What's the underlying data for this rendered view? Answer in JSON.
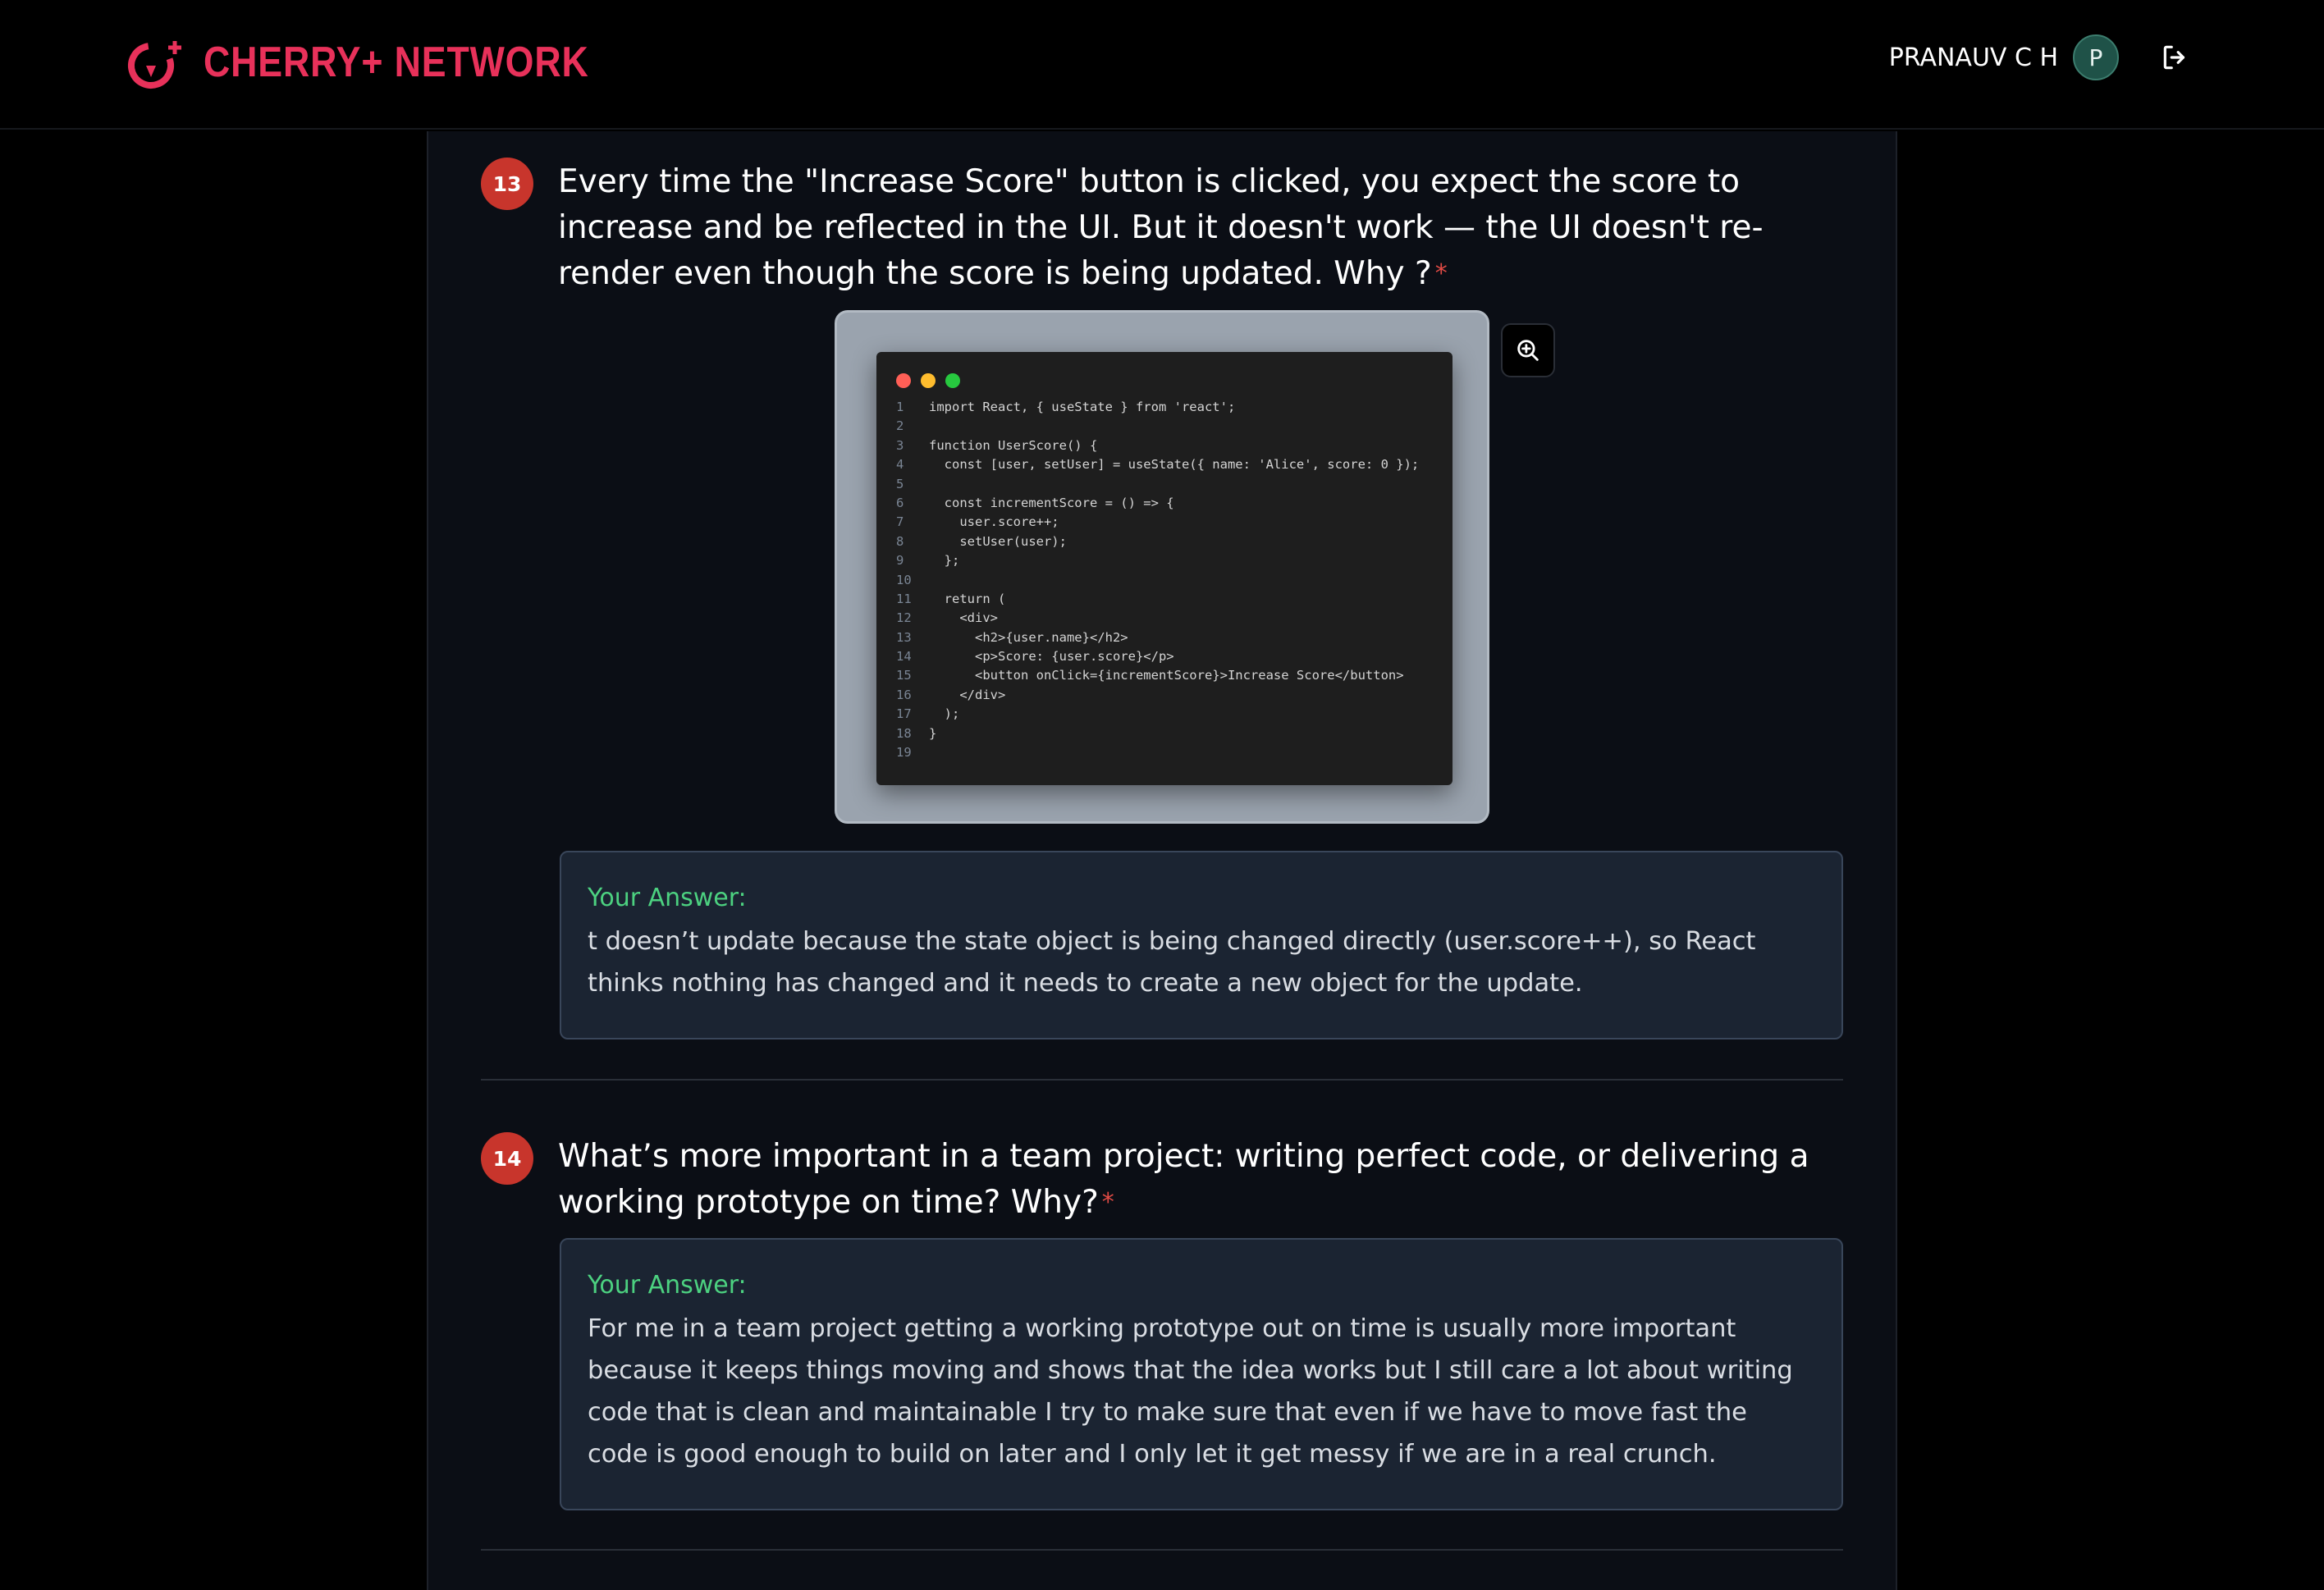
{
  "header": {
    "brand": "CHERRY+ NETWORK",
    "user_name": "PRANAUV C H",
    "avatar_initial": "P",
    "brand_color": "#e8315a",
    "logout_icon": "logout-icon"
  },
  "questions": [
    {
      "number": "13",
      "text": "Every time the \"Increase Score\" button is clicked, you expect the score to increase and be reflected in the UI. But it doesn't work — the UI doesn't re-render even though the score is being updated. Why ?",
      "required_mark": "*",
      "code": [
        {
          "n": "1",
          "t": "import React, { useState } from 'react';"
        },
        {
          "n": "2",
          "t": ""
        },
        {
          "n": "3",
          "t": "function UserScore() {"
        },
        {
          "n": "4",
          "t": "  const [user, setUser] = useState({ name: 'Alice', score: 0 });"
        },
        {
          "n": "5",
          "t": ""
        },
        {
          "n": "6",
          "t": "  const incrementScore = () => {"
        },
        {
          "n": "7",
          "t": "    user.score++;"
        },
        {
          "n": "8",
          "t": "    setUser(user);"
        },
        {
          "n": "9",
          "t": "  };"
        },
        {
          "n": "10",
          "t": ""
        },
        {
          "n": "11",
          "t": "  return ("
        },
        {
          "n": "12",
          "t": "    <div>"
        },
        {
          "n": "13",
          "t": "      <h2>{user.name}</h2>"
        },
        {
          "n": "14",
          "t": "      <p>Score: {user.score}</p>"
        },
        {
          "n": "15",
          "t": "      <button onClick={incrementScore}>Increase Score</button>"
        },
        {
          "n": "16",
          "t": "    </div>"
        },
        {
          "n": "17",
          "t": "  );"
        },
        {
          "n": "18",
          "t": "}"
        },
        {
          "n": "19",
          "t": ""
        }
      ],
      "answer_label": "Your Answer:",
      "answer": "t doesn’t update because the state object is being changed directly (user.score++), so React thinks nothing has changed and it needs to create a new object for the update."
    },
    {
      "number": "14",
      "text": "What’s more important in a team project: writing perfect code, or delivering a working prototype on time? Why?",
      "required_mark": "*",
      "answer_label": "Your Answer:",
      "answer": "For me in a team project getting a working prototype out on time is usually more important because it keeps things moving and shows that the idea works but I still care a lot about writing code that is clean and maintainable I try to make sure that even if we have to move fast the code is good enough to build on later and I only let it get messy if we are in a real crunch."
    }
  ],
  "colors": {
    "badge": "#c8352c",
    "answer_label": "#4cd180",
    "required": "#e24b45"
  }
}
